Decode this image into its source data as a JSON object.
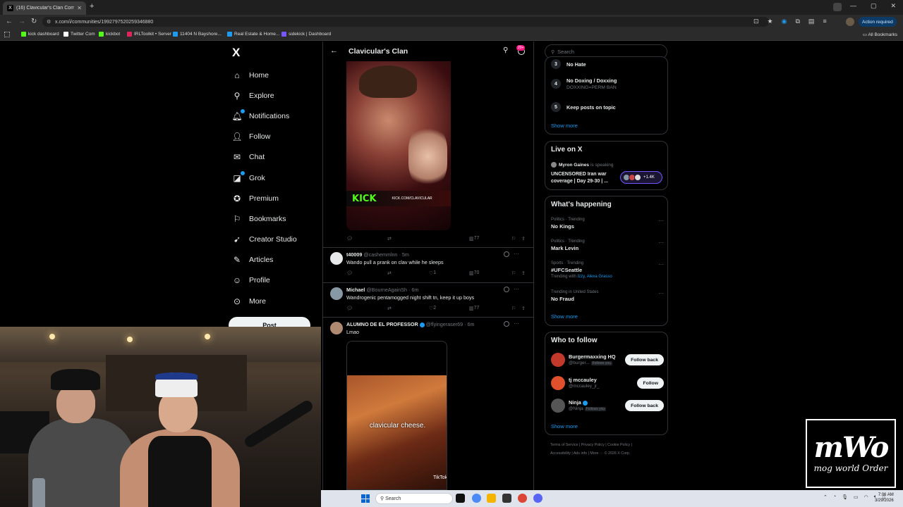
{
  "browser": {
    "tab_title": "(16) Clavicular's Clan Commun...",
    "tab_favicon": "X",
    "url": "x.com/i/communities/1992797520259346880",
    "action_required": "Action required",
    "bookmarks": [
      {
        "label": "kick dashboard",
        "color": "#53fc18"
      },
      {
        "label": "Twitter Com",
        "color": "#ffffff"
      },
      {
        "label": "kickbot",
        "color": "#53fc18"
      },
      {
        "label": "IRLToolkit • Server",
        "color": "#e0245e"
      },
      {
        "label": "11404 N Bayshore...",
        "color": "#1d9bf0"
      },
      {
        "label": "Real Estate & Home...",
        "color": "#1d9bf0"
      },
      {
        "label": "sidekick | Dashboard",
        "color": "#7856ff"
      }
    ],
    "all_bookmarks": "All Bookmarks"
  },
  "nav": {
    "logo": "X",
    "items": [
      {
        "label": "Home",
        "icon": "home-icon"
      },
      {
        "label": "Explore",
        "icon": "search-icon"
      },
      {
        "label": "Notifications",
        "icon": "bell-icon"
      },
      {
        "label": "Follow",
        "icon": "follow-icon"
      },
      {
        "label": "Chat",
        "icon": "mail-icon"
      },
      {
        "label": "Grok",
        "icon": "grok-icon"
      },
      {
        "label": "Premium",
        "icon": "premium-icon"
      },
      {
        "label": "Bookmarks",
        "icon": "bookmark-icon"
      },
      {
        "label": "Creator Studio",
        "icon": "rocket-icon"
      },
      {
        "label": "Articles",
        "icon": "article-icon"
      },
      {
        "label": "Profile",
        "icon": "person-icon"
      },
      {
        "label": "More",
        "icon": "more-circle-icon"
      }
    ],
    "post_label": "Post"
  },
  "main": {
    "header_title": "Clavicular's Clan",
    "notif_badge": "20+",
    "media1": {
      "kick_text": "KICK",
      "kick_url": "KICK.COM/CLAVICULAR"
    },
    "first_actions": {
      "views": "77"
    },
    "tweets": [
      {
        "name": "t40009",
        "handle": "@cashemmlnn · 5m",
        "text": "Wando pull a prank on clav while he sleeps",
        "likes": "1",
        "views": "70",
        "avatar_color": "#e7e9ea"
      },
      {
        "name": "Michael",
        "handle": "@BourneAgainSh · 6m",
        "text": "Wandrogenic pentamogged night shift tn, keep it up boys",
        "likes": "2",
        "views": "77",
        "avatar_color": "#8899a6"
      },
      {
        "name": "ALUMNO DE EL PROFESSOR",
        "handle": "@flyingeraser69 · 6m",
        "text": "Lmao",
        "avatar_color": "#b08a70"
      }
    ],
    "media2": {
      "caption": "clavicular cheese.",
      "watermark": "TikTok"
    }
  },
  "right": {
    "search_placeholder": "Search",
    "rules": [
      {
        "num": "3",
        "title": "No Hate",
        "sub": ""
      },
      {
        "num": "4",
        "title": "No Doxing / Doxxing",
        "sub": "DOXXING=PERM BAN"
      },
      {
        "num": "5",
        "title": "Keep posts on topic",
        "sub": ""
      }
    ],
    "show_more": "Show more",
    "live": {
      "title": "Live on X",
      "host": "Myron Gaines",
      "host_suffix": "is speaking",
      "text": "UNCENSORED Iran war coverage | Day 29-30 | ...",
      "count": "+1.4K"
    },
    "happening": {
      "title": "What's happening",
      "trends": [
        {
          "category": "Politics · Trending",
          "name": "No Kings",
          "with_label": "",
          "with_links": ""
        },
        {
          "category": "Politics · Trending",
          "name": "Mark Levin",
          "with_label": "",
          "with_links": ""
        },
        {
          "category": "Sports · Trending",
          "name": "#UFCSeattle",
          "with_label": "Trending with",
          "with_links": "Izzy, Alexa Grasso"
        },
        {
          "category": "Trending in United States",
          "name": "No Fraud",
          "with_label": "",
          "with_links": ""
        }
      ]
    },
    "who_to_follow": {
      "title": "Who to follow",
      "accounts": [
        {
          "name": "Burgermaxxing HQ",
          "handle": "@burger...",
          "follows_you": "Follows you",
          "button": "Follow back",
          "avatar_color": "#c0392b"
        },
        {
          "name": "tj mccauley",
          "handle": "@mccauley_jr_",
          "follows_you": "",
          "button": "Follow",
          "avatar_color": "#e0502c"
        },
        {
          "name": "Ninja",
          "handle": "@Ninja",
          "follows_you": "Follows you",
          "button": "Follow back",
          "avatar_color": "#555555"
        }
      ]
    },
    "footer_line1": "Terms of Service  |  Privacy Policy  |  Cookie Policy  |",
    "footer_line2": "Accessibility  |  Ads info  |  More ···  © 2026 X Corp."
  },
  "overlay": {
    "logo_big": "mWo",
    "logo_small": "mog world Order"
  },
  "taskbar": {
    "search": "Search",
    "time": "7:06 AM",
    "date": "3/29/2026"
  }
}
